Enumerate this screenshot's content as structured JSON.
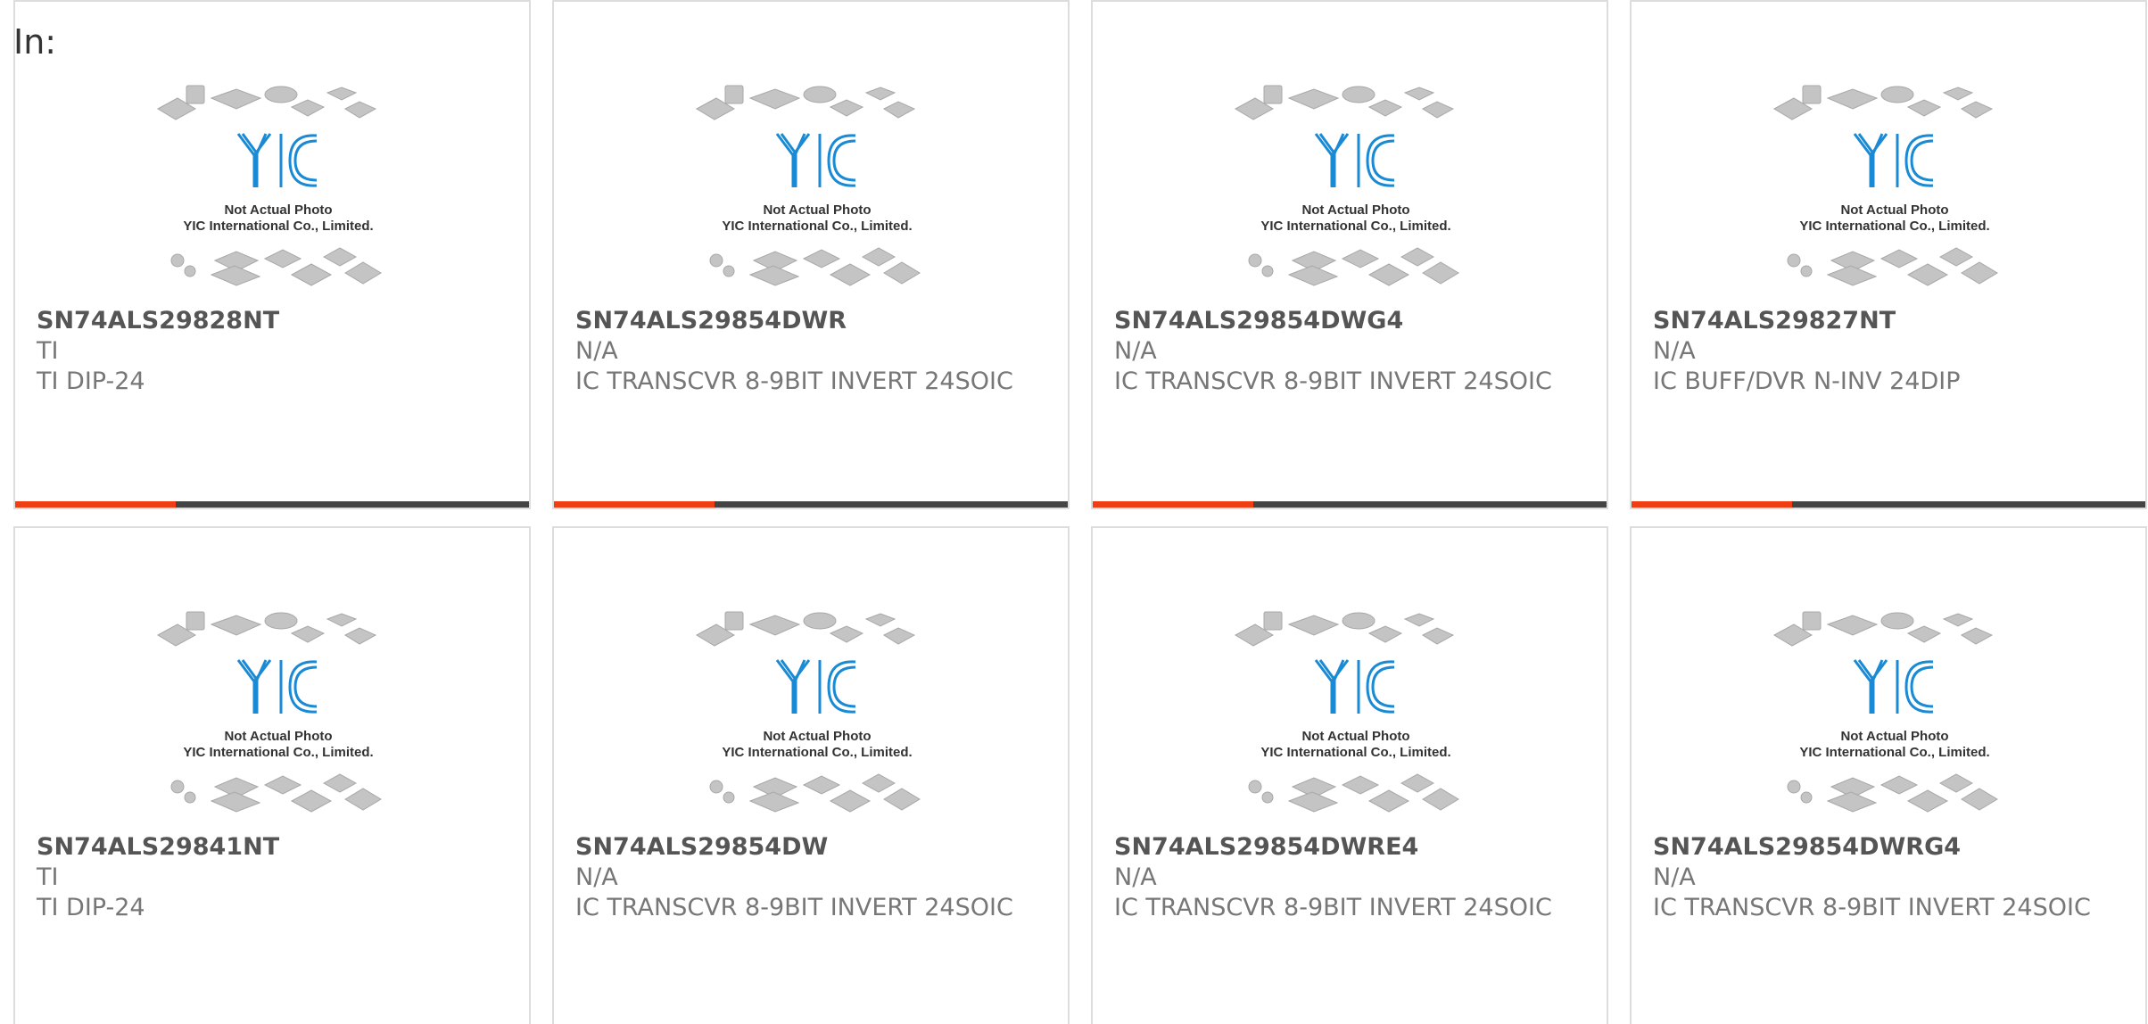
{
  "header": {
    "label": "In:"
  },
  "photo": {
    "brand": "YIC",
    "caption_line1": "Not Actual Photo",
    "caption_line2": "YIC International Co., Limited."
  },
  "colors": {
    "accent": "#ef3e14",
    "bar": "#444444",
    "logo_blue": "#1a8ad4"
  },
  "products": [
    {
      "part": "SN74ALS29828NT",
      "mfr": "TI",
      "desc": "TI DIP-24"
    },
    {
      "part": "SN74ALS29854DWR",
      "mfr": "N/A",
      "desc": "IC TRANSCVR 8-9BIT INVERT 24SOIC"
    },
    {
      "part": "SN74ALS29854DWG4",
      "mfr": "N/A",
      "desc": "IC TRANSCVR 8-9BIT INVERT 24SOIC"
    },
    {
      "part": "SN74ALS29827NT",
      "mfr": "N/A",
      "desc": "IC BUFF/DVR N-INV 24DIP"
    },
    {
      "part": "SN74ALS29841NT",
      "mfr": "TI",
      "desc": "TI DIP-24"
    },
    {
      "part": "SN74ALS29854DW",
      "mfr": "N/A",
      "desc": "IC TRANSCVR 8-9BIT INVERT 24SOIC"
    },
    {
      "part": "SN74ALS29854DWRE4",
      "mfr": "N/A",
      "desc": "IC TRANSCVR 8-9BIT INVERT 24SOIC"
    },
    {
      "part": "SN74ALS29854DWRG4",
      "mfr": "N/A",
      "desc": "IC TRANSCVR 8-9BIT INVERT 24SOIC"
    }
  ]
}
